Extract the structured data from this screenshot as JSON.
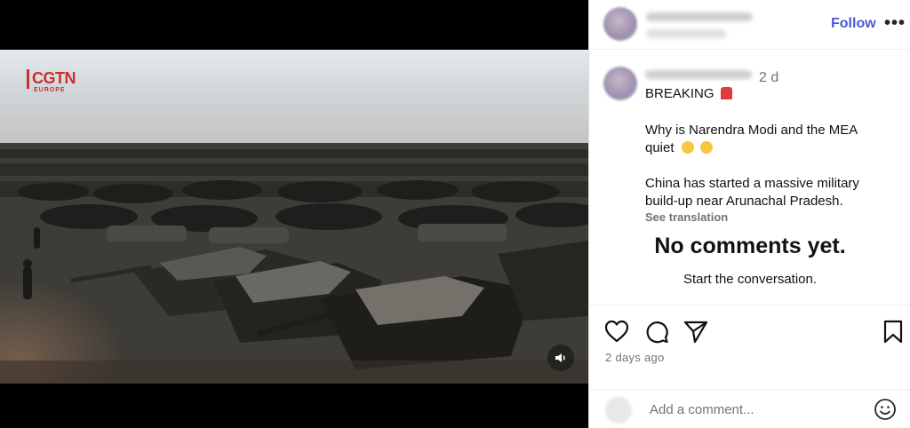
{
  "media": {
    "logo_text": "CGTN",
    "logo_sub": "EUROPE",
    "mute_icon": "speaker-icon"
  },
  "header": {
    "follow_label": "Follow",
    "more_label": "•••"
  },
  "post": {
    "time": "2 d",
    "caption": {
      "line1": "BREAKING",
      "line2": "Why is Narendra Modi and the MEA",
      "line3": "quiet",
      "line4": "China has started a massive military",
      "line5": "build-up near Arunachal Pradesh."
    },
    "see_translation": "See translation",
    "no_comments_title": "No comments yet.",
    "no_comments_sub": "Start the conversation."
  },
  "actions": {
    "like_icon": "heart-icon",
    "comment_icon": "comment-icon",
    "share_icon": "send-icon",
    "save_icon": "bookmark-icon",
    "posted_ago": "2 days ago"
  },
  "comment_box": {
    "placeholder": "Add a comment...",
    "emoji_icon": "smiley-icon"
  },
  "colors": {
    "follow": "#4a5ad8",
    "muted_text": "#737373",
    "logo_red": "#c9302c"
  }
}
